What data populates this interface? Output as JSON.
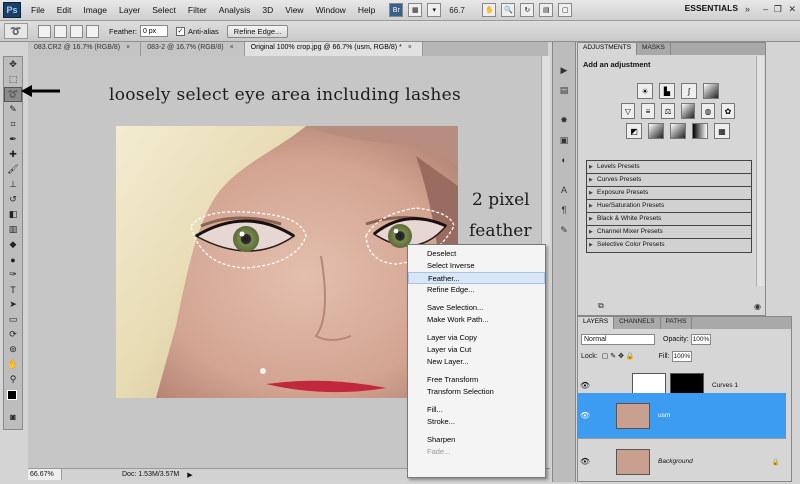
{
  "app": {
    "logo": "Ps",
    "menu": [
      "File",
      "Edit",
      "Image",
      "Layer",
      "Select",
      "Filter",
      "Analysis",
      "3D",
      "View",
      "Window",
      "Help"
    ],
    "bridge_label": "Br",
    "zoom_menu": "66.7",
    "workspace": "ESSENTIALS"
  },
  "options_bar": {
    "feather_label": "Feather:",
    "feather_value": "0 px",
    "anti_alias_label": "Anti-alias",
    "refine_edge_label": "Refine Edge..."
  },
  "tabs": [
    {
      "label": "083.CR2 @ 16.7% (RGB/8)"
    },
    {
      "label": "083-2 @ 16.7% (RGB/8)"
    },
    {
      "label": "Original 100% crop.jpg @ 66.7% (usm, RGB/8) *"
    }
  ],
  "annotations": {
    "instruction": "loosely select eye area including lashes",
    "feather_note_1": "2 pixel",
    "feather_note_2": "feather"
  },
  "context_menu": {
    "items": [
      "Deselect",
      "Select Inverse",
      "Feather...",
      "Refine Edge...",
      "Save Selection...",
      "Make Work Path...",
      "Layer via Copy",
      "Layer via Cut",
      "New Layer...",
      "Free Transform",
      "Transform Selection",
      "Fill...",
      "Stroke...",
      "Sharpen",
      "Fade..."
    ],
    "highlighted": "Feather..."
  },
  "status_bar": {
    "zoom": "66.67%",
    "doc": "Doc: 1.53M/3.57M"
  },
  "adjustments_panel": {
    "tab_adjustments": "ADJUSTMENTS",
    "tab_masks": "MASKS",
    "title": "Add an adjustment",
    "presets": [
      "Levels Presets",
      "Curves Presets",
      "Exposure Presets",
      "Hue/Saturation Presets",
      "Black & White Presets",
      "Channel Mixer Presets",
      "Selective Color Presets"
    ]
  },
  "layers_panel": {
    "tab_layers": "LAYERS",
    "tab_channels": "CHANNELS",
    "tab_paths": "PATHS",
    "blend_mode": "Normal",
    "opacity_label": "Opacity:",
    "opacity_value": "100%",
    "lock_label": "Lock:",
    "fill_label": "Fill:",
    "fill_value": "100%",
    "layers": [
      {
        "name": "Curves 1"
      },
      {
        "name": "usm"
      },
      {
        "name": "Background"
      }
    ]
  },
  "colors": {
    "selected_layer": "#3c9df0",
    "menu_highlight": "#d8e6f5"
  }
}
